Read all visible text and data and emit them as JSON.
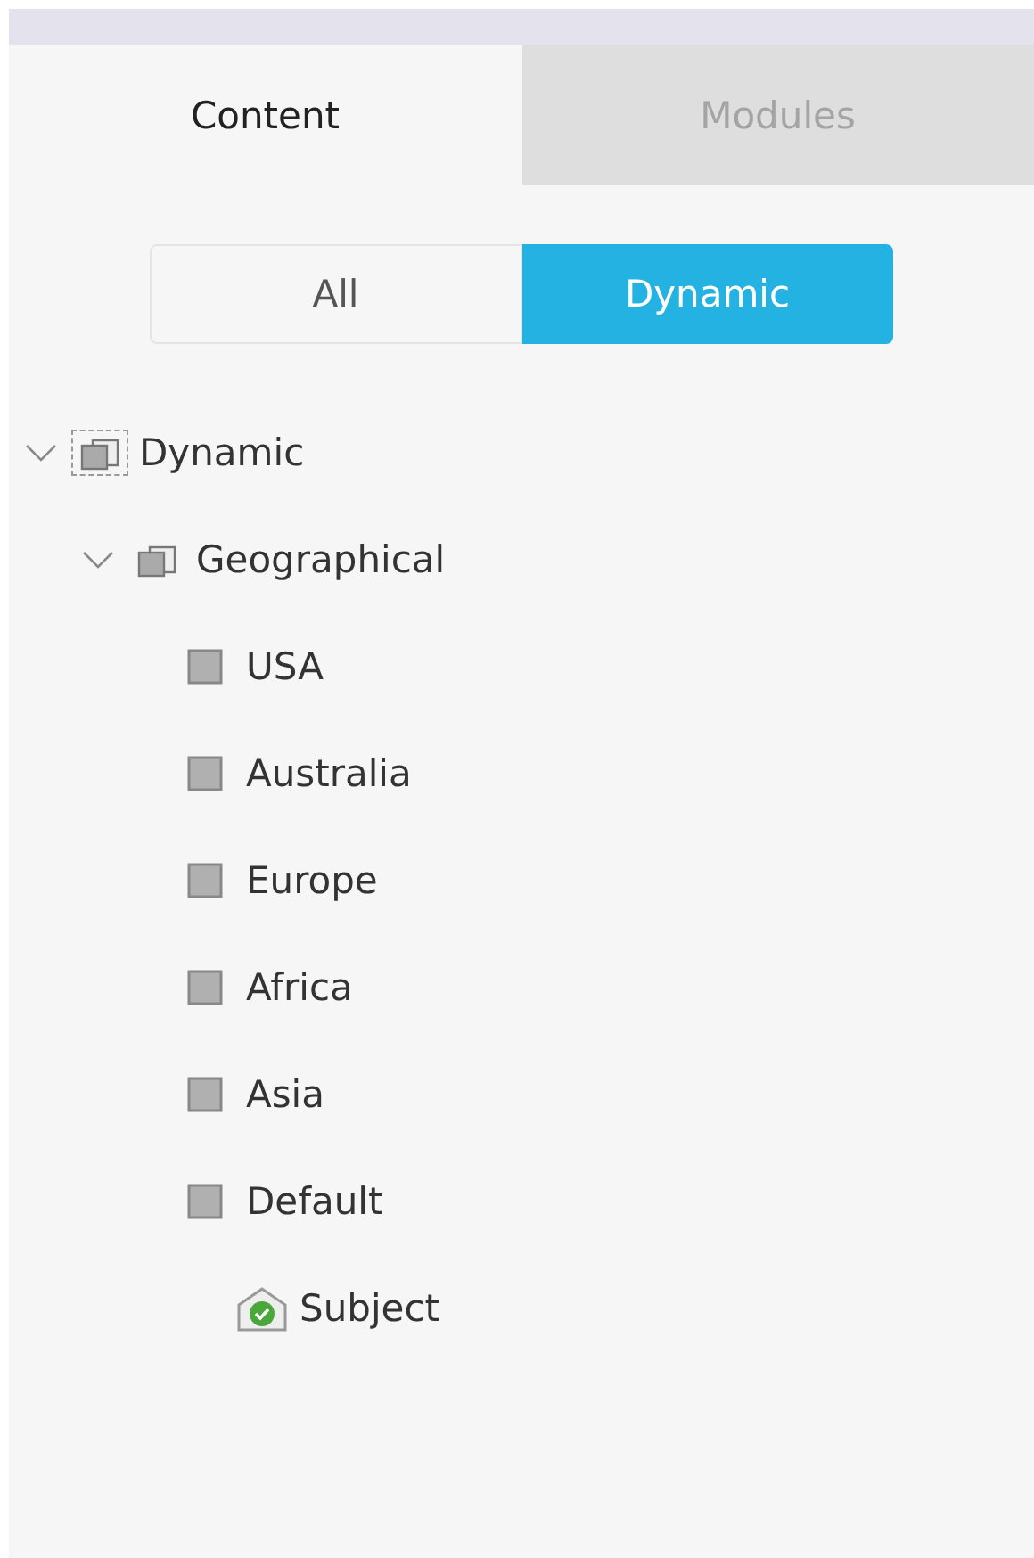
{
  "tabs": [
    {
      "label": "Content",
      "selected": true,
      "disabled": false
    },
    {
      "label": "Modules",
      "selected": false,
      "disabled": true
    }
  ],
  "filter": [
    {
      "label": "All",
      "selected": false
    },
    {
      "label": "Dynamic",
      "selected": true
    }
  ],
  "tree": [
    {
      "label": "Dynamic",
      "kind": "group",
      "expanded": true,
      "selected": true,
      "children": [
        {
          "label": "Geographical",
          "kind": "group",
          "expanded": true,
          "selected": false,
          "children": [
            {
              "label": "USA",
              "kind": "segment",
              "selected": false
            },
            {
              "label": "Australia",
              "kind": "segment",
              "selected": false
            },
            {
              "label": "Europe",
              "kind": "segment",
              "selected": false
            },
            {
              "label": "Africa",
              "kind": "segment",
              "selected": false
            },
            {
              "label": "Asia",
              "kind": "segment",
              "selected": false
            },
            {
              "label": "Default",
              "kind": "segment",
              "selected": false,
              "children": [
                {
                  "label": "Subject",
                  "kind": "subject",
                  "selected": false
                }
              ]
            }
          ]
        }
      ]
    }
  ]
}
